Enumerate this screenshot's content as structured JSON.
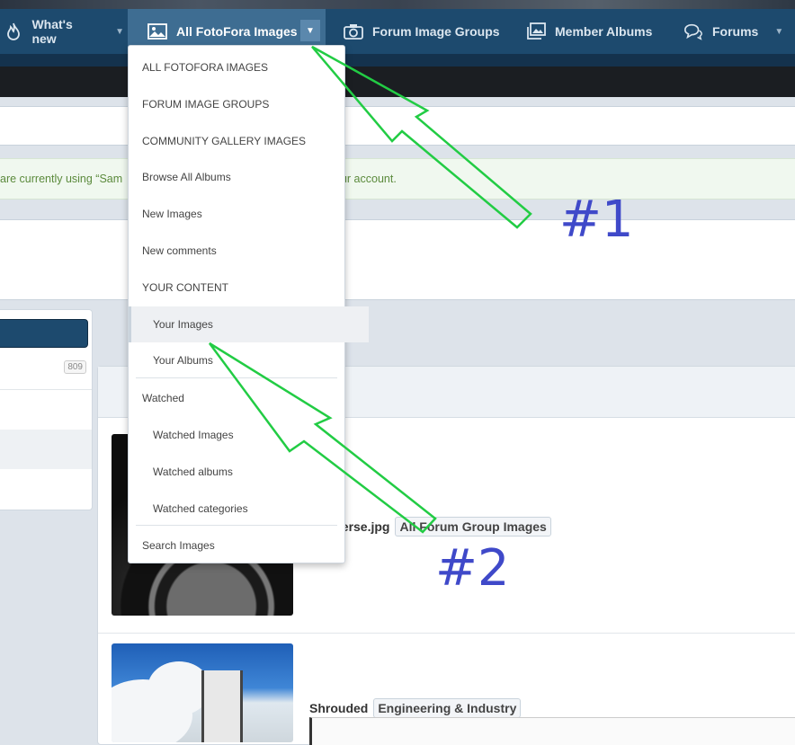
{
  "nav": {
    "tabs": [
      {
        "label": "What's new",
        "icon": "flame-icon"
      },
      {
        "label": "All FotoFora Images",
        "icon": "image-icon"
      },
      {
        "label": "Forum Image Groups",
        "icon": "camera-icon"
      },
      {
        "label": "Member Albums",
        "icon": "photos-icon"
      },
      {
        "label": "Forums",
        "icon": "chat-icon"
      }
    ]
  },
  "notice": {
    "left_text": "are currently using “Sam",
    "right_text": "our account."
  },
  "sidebar": {
    "count": "809"
  },
  "menu": {
    "items": [
      "ALL FOTOFORA IMAGES",
      "FORUM IMAGE GROUPS",
      "COMMUNITY GALLERY IMAGES",
      "Browse All Albums",
      "New Images",
      "New comments",
      "YOUR CONTENT",
      "Your Images",
      "Your Albums",
      "Watched",
      "Watched Images",
      "Watched albums",
      "Watched categories",
      "Search Images"
    ]
  },
  "content": {
    "row1": {
      "title": "verse.jpg",
      "category": "All Forum Group Images"
    },
    "row2": {
      "title": "Shrouded",
      "category": "Engineering & Industry"
    }
  },
  "annotations": {
    "first": "#1",
    "second": "#2"
  },
  "colors": {
    "nav": "#1d4a6e",
    "arrow": "#22cc44",
    "annotation": "#3f49c9"
  }
}
